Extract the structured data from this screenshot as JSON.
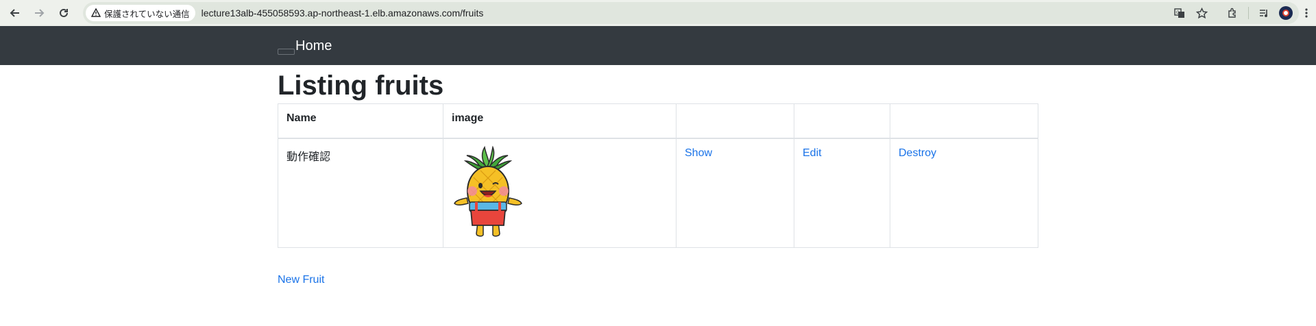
{
  "browser": {
    "security_label": "保護されていない通信",
    "url": "lecture13alb-455058593.ap-northeast-1.elb.amazonaws.com/fruits"
  },
  "navbar": {
    "brand": "Home"
  },
  "page": {
    "title": "Listing fruits",
    "new_link": "New Fruit"
  },
  "table": {
    "headers": [
      "Name",
      "image",
      "",
      "",
      ""
    ],
    "rows": [
      {
        "name": "動作確認",
        "image_alt": "pineapple-character",
        "show": "Show",
        "edit": "Edit",
        "destroy": "Destroy"
      }
    ]
  },
  "colors": {
    "navbar_bg": "#343a40",
    "link": "#1a73e8",
    "chrome_bg": "#eef1ec"
  }
}
